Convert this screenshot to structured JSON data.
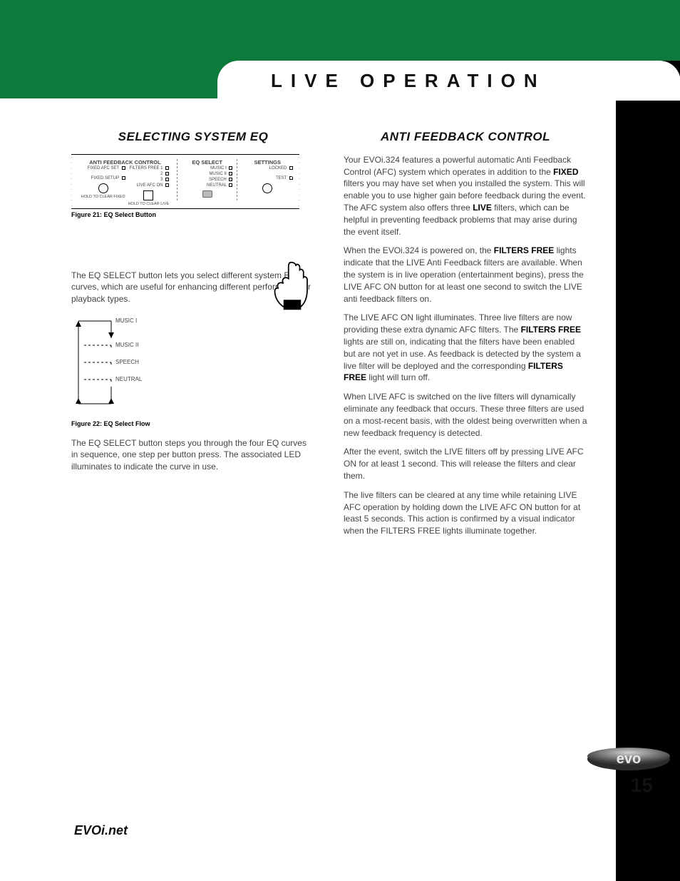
{
  "header": {
    "title": "LIVE OPERATION"
  },
  "left": {
    "heading": "SELECTING SYSTEM EQ",
    "panel": {
      "sec_afc": "ANTI FEEDBACK CONTROL",
      "sec_eq": "EQ SELECT",
      "sec_settings": "SETTINGS",
      "filters_free": "FILTERS FREE",
      "fixed_afc_set": "FIXED AFC SET",
      "fixed_setup": "FIXED SETUP",
      "live_afc_on": "LIVE AFC ON",
      "hold_clear_fixed": "HOLD TO CLEAR FIXED",
      "hold_clear_live": "HOLD TO CLEAR LIVE",
      "music1": "MUSIC I",
      "music2": "MUSIC II",
      "speech": "SPEECH",
      "neutral": "NEUTRAL",
      "locked": "LOCKED",
      "test": "TEST",
      "num1": "1",
      "num2": "2",
      "num3": "3"
    },
    "figure_caption": "Figure 21: EQ Select Button",
    "p1": "The EQ SELECT button lets you select different system EQ curves, which are useful for enhancing different performance or playback types.",
    "eq_music1": "MUSIC I",
    "eq_music2": "MUSIC II",
    "eq_speech": "SPEECH",
    "eq_neutral": "NEUTRAL",
    "flow_caption": "Figure 22: EQ Select Flow",
    "p2": "The EQ SELECT button steps you through the four EQ curves in sequence, one step per button press. The associated LED illuminates to indicate the curve in use."
  },
  "right": {
    "heading": "ANTI FEEDBACK CONTROL",
    "p1a": "Your EVOi.324 features a powerful automatic Anti Feedback Control (AFC) system which operates in addition to the ",
    "bold_fixed": "FIXED",
    "p1b": " filters you may have set when you installed the system. This will enable you to use higher gain before feedback during the event. The AFC system also offers three ",
    "bold_live": "LIVE",
    "p1c": " filters, which can be helpful in preventing feedback problems that may arise during the event itself.",
    "p2a": "When the EVOi.324 is powered on, the ",
    "filters_free_1": "FILTERS FREE",
    "p2b": " lights indicate that the LIVE Anti Feedback filters are available. When the system is in live operation (entertainment begins), press the LIVE AFC ON button for at least one second to switch the LIVE anti feedback filters on.",
    "p3a": "The LIVE AFC ON light illuminates. Three live filters are now providing these extra dynamic AFC filters. The ",
    "filters_free_2": "FILTERS FREE",
    "p3b": " lights are still on, indicating that the filters have been enabled but are not yet in use. As feedback is detected by the system a live filter will be deployed and the corresponding ",
    "filters_free_3": "FILTERS FREE",
    "p3c": " light will turn off.",
    "p4": "When LIVE AFC is switched on the live filters will dynamically eliminate any feedback that occurs. These three filters are used on a most-recent basis, with the oldest being overwritten when a new feedback frequency is detected.",
    "p5": "After the event, switch the LIVE filters off by pressing LIVE AFC ON for at least 1 second. This will release the filters and clear them.",
    "p6": "The live filters can be cleared at any time while retaining LIVE AFC operation by holding down the LIVE AFC ON button for at least 5 seconds. This action is confirmed by a visual indicator when the FILTERS FREE lights illuminate together."
  },
  "footer": {
    "url": "EVOi.net",
    "page": "15",
    "logo_text": "evo"
  }
}
